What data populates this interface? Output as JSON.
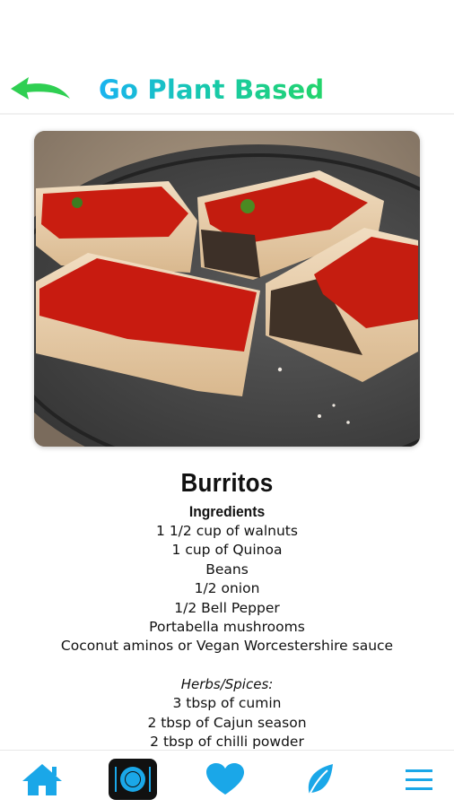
{
  "app": {
    "brand": "Go Plant Based"
  },
  "colors": {
    "accent_green": "#2fcf52",
    "accent_blue": "#1aa7e8",
    "tab_icon": "#1aa7e8",
    "active_tab_bg": "#111111"
  },
  "header": {
    "back_icon": "back-arrow-icon"
  },
  "recipe": {
    "title": "Burritos",
    "ingredients_heading": "Ingredients",
    "ingredients": [
      "1 1/2 cup of walnuts",
      "1 cup of Quinoa",
      "Beans",
      "1/2 onion",
      "1/2 Bell Pepper",
      "Portabella mushrooms",
      "Coconut aminos or Vegan Worcestershire sauce"
    ],
    "spices_heading": "Herbs/Spices:",
    "spices": [
      "3 tbsp of cumin",
      "2 tbsp of Cajun season",
      "2 tbsp of chilli powder"
    ]
  },
  "tabs": [
    {
      "id": "home",
      "icon": "home-icon"
    },
    {
      "id": "recipes",
      "icon": "plate-icon",
      "active": true
    },
    {
      "id": "favorites",
      "icon": "heart-icon"
    },
    {
      "id": "plant",
      "icon": "leaf-icon"
    },
    {
      "id": "menu",
      "icon": "hamburger-menu-icon"
    }
  ]
}
